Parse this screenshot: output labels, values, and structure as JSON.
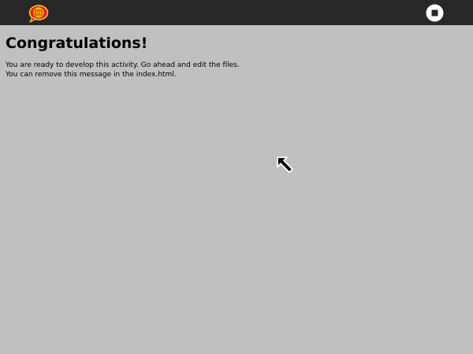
{
  "toolbar": {
    "activity_icon": "speech-bubble-globe-icon",
    "stop_icon": "stop-icon",
    "background_color": "#282828"
  },
  "content": {
    "title": "Congratulations!",
    "message_lines": [
      "You are ready to develop this activity. Go ahead and edit the files.",
      "You can remove this message in the index.html."
    ],
    "background_color": "#c0c0c0"
  },
  "cursor": {
    "icon": "arrow-cursor-icon"
  }
}
